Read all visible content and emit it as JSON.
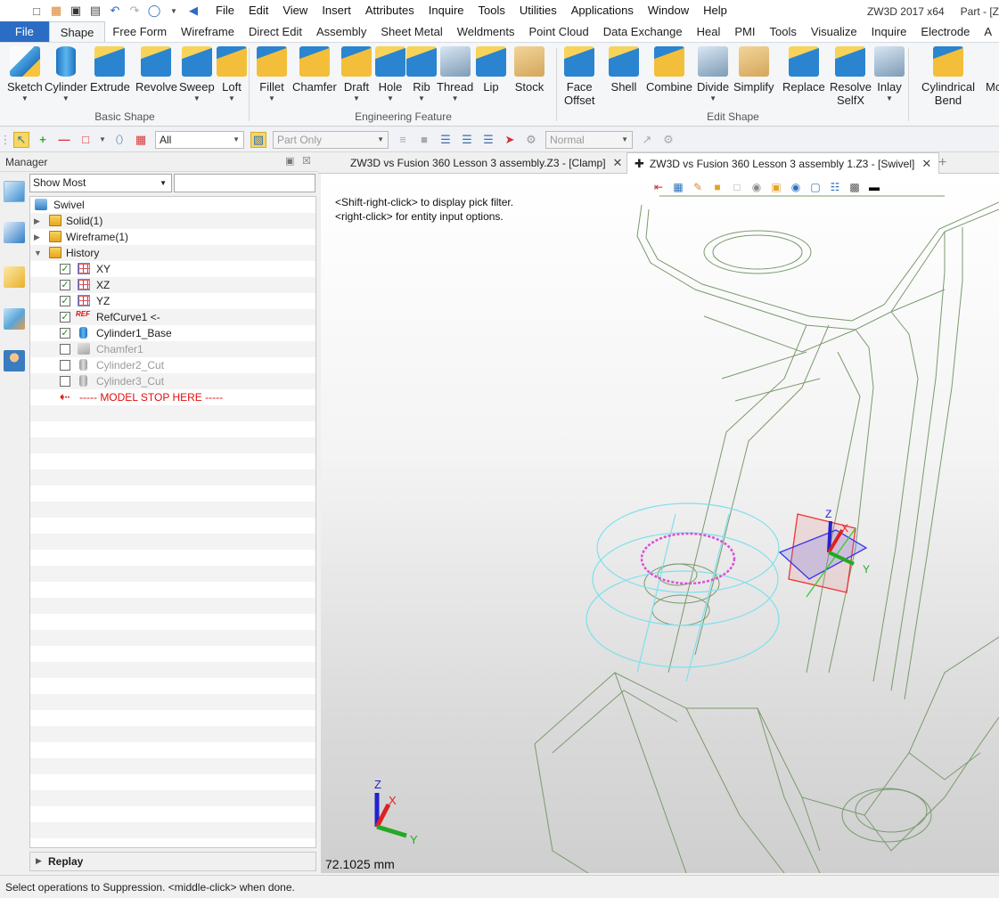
{
  "quick_access": {
    "icons": [
      "new-icon",
      "open-icon",
      "save-icon",
      "print-icon",
      "undo-icon",
      "redo-icon",
      "select-icon",
      "dropdown-icon",
      "back-icon"
    ]
  },
  "menu": [
    "File",
    "Edit",
    "View",
    "Insert",
    "Attributes",
    "Inquire",
    "Tools",
    "Utilities",
    "Applications",
    "Window",
    "Help"
  ],
  "app_title": "ZW3D 2017  x64",
  "part_title": "Part - [Z",
  "ribbon_tabs": [
    "File",
    "Shape",
    "Free Form",
    "Wireframe",
    "Direct Edit",
    "Assembly",
    "Sheet Metal",
    "Weldments",
    "Point Cloud",
    "Data Exchange",
    "Heal",
    "PMI",
    "Tools",
    "Visualize",
    "Inquire",
    "Electrode",
    "A"
  ],
  "active_tab": "Shape",
  "groups": {
    "basic": {
      "label": "Basic Shape",
      "buttons": [
        "Sketch",
        "Cylinder",
        "Extrude",
        "Revolve",
        "Sweep",
        "Loft"
      ]
    },
    "eng": {
      "label": "Engineering Feature",
      "buttons": [
        "Fillet",
        "Chamfer",
        "Draft",
        "Hole",
        "Rib",
        "Thread",
        "Lip",
        "Stock"
      ]
    },
    "edit": {
      "label": "Edit Shape",
      "buttons": [
        "Face\nOffset",
        "Shell",
        "Combine",
        "Divide",
        "Simplify",
        "Replace",
        "Resolve\nSelfX",
        "Inlay"
      ]
    },
    "extra": {
      "buttons": [
        "Cylindrical\nBend",
        "Mo"
      ]
    }
  },
  "toolbar": {
    "filter": "All",
    "scope": "Part Only",
    "mode": "Normal"
  },
  "manager": {
    "title": "Manager",
    "show_select": "Show Most",
    "root": "Swivel",
    "items": [
      {
        "label": "Solid(1)",
        "checked": null
      },
      {
        "label": "Wireframe(1)",
        "checked": null
      },
      {
        "label": "History",
        "checked": null
      },
      {
        "label": "XY",
        "checked": true
      },
      {
        "label": "XZ",
        "checked": true
      },
      {
        "label": "YZ",
        "checked": true
      },
      {
        "label": "RefCurve1 <-",
        "checked": true
      },
      {
        "label": "Cylinder1_Base",
        "checked": true
      },
      {
        "label": "Chamfer1",
        "checked": false
      },
      {
        "label": "Cylinder2_Cut",
        "checked": false
      },
      {
        "label": "Cylinder3_Cut",
        "checked": false
      }
    ],
    "stop_label": "----- MODEL STOP HERE -----",
    "ref_badge": "REF",
    "replay": "Replay"
  },
  "doc_tabs": [
    "ZW3D vs Fusion 360 Lesson 3 assembly.Z3 - [Clamp]",
    "ZW3D vs Fusion 360 Lesson 3 assembly 1.Z3 - [Swivel]"
  ],
  "viewport": {
    "hint1": "<Shift-right-click> to display pick filter.",
    "hint2": "<right-click> for entity input options.",
    "measure": "72.1025 mm",
    "axes": {
      "x": "X",
      "y": "Y",
      "z": "Z"
    }
  },
  "status": "Select operations to Suppression.  <middle-click> when done."
}
